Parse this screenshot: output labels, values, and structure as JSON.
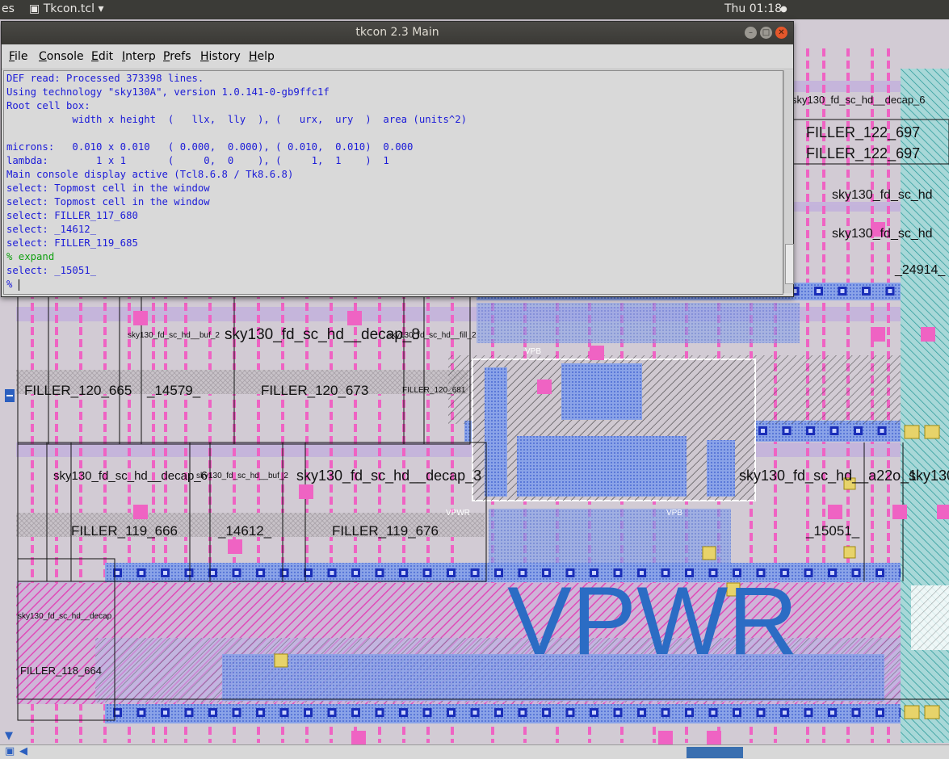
{
  "topbar": {
    "left_text": "es",
    "app_menu": "Tkcon.tcl",
    "clock": "Thu 01:18"
  },
  "window": {
    "title": "tkcon 2.3 Main",
    "menu": [
      "File",
      "Console",
      "Edit",
      "Interp",
      "Prefs",
      "History",
      "Help"
    ]
  },
  "console_lines": [
    {
      "text": "DEF read: Processed 373398 lines."
    },
    {
      "text": "Using technology \"sky130A\", version 1.0.141-0-gb9ffc1f"
    },
    {
      "text": "Root cell box:"
    },
    {
      "text": "           width x height  (   llx,  lly  ), (   urx,  ury  )  area (units^2)"
    },
    {
      "text": ""
    },
    {
      "text": "microns:   0.010 x 0.010   ( 0.000,  0.000), ( 0.010,  0.010)  0.000"
    },
    {
      "text": "lambda:        1 x 1       (     0,  0    ), (     1,  1    )  1"
    },
    {
      "text": "Main console display active (Tcl8.6.8 / Tk8.6.8)"
    },
    {
      "text": "select: Topmost cell in the window"
    },
    {
      "text": "select: Topmost cell in the window"
    },
    {
      "text": "select: FILLER_117_680"
    },
    {
      "text": "select: _14612_"
    },
    {
      "text": "select: FILLER_119_685"
    },
    {
      "text": "% expand",
      "style": "ok"
    },
    {
      "text": "select: _15051_"
    },
    {
      "text": "% ",
      "cursor": true
    }
  ],
  "layout_labels": [
    "sky130_fd_sc_hd__decap_6",
    "FILLER_122_697",
    "FILLER_122_697",
    "sky130_fd_sc_hd",
    "sky130_fd_sc_hd",
    "_24914_",
    "sky130_fd_sc_hd__decap_8",
    "sky130_fd_sc_hd__buf_2",
    "sky130_fd_sc_hd__fill_2",
    "FILLER_120_665",
    "_14579_",
    "FILLER_120_673",
    "FILLER_120_681",
    "sky130_fd_sc_hd__decap_6",
    "sky130_fd_sc_hd__buf_2",
    "sky130_fd_sc_hd__decap_3",
    "sky130_fd_sc_hd__a22o_1",
    "sky130",
    "FILLER_119_666",
    "_14612_",
    "FILLER_119_676",
    "_15051_",
    "sky130_fd_sc_hd__decap",
    "FILLER_118_664",
    "VPB",
    "VPWR",
    "VPB",
    "VPWR"
  ],
  "colors": {
    "console_text": "#1b1bd8",
    "console_green": "#10a010",
    "poly_pink": "#f06ac8",
    "metal_blue": "#6f8fe8",
    "vpwr_blue": "#2b6cc4"
  }
}
